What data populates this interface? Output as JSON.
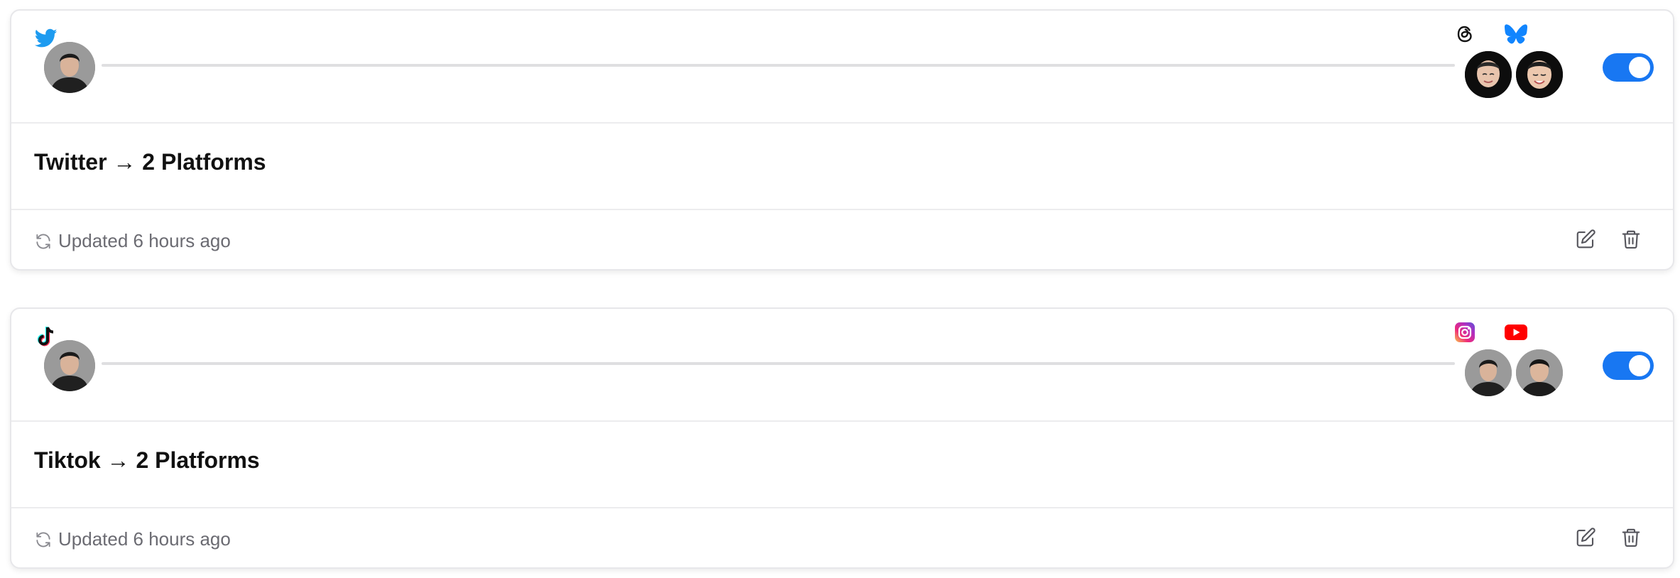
{
  "rules": [
    {
      "source_platform": "twitter-icon",
      "target_platforms": [
        "threads-icon",
        "bluesky-icon"
      ],
      "enabled": true,
      "title": "Twitter → 2 Platforms",
      "updated_label": "Updated 6 hours ago"
    },
    {
      "source_platform": "tiktok-icon",
      "target_platforms": [
        "instagram-icon",
        "youtube-icon"
      ],
      "enabled": true,
      "title": "Tiktok → 2 Platforms",
      "updated_label": "Updated 6 hours ago"
    }
  ],
  "colors": {
    "toggle_on": "#1877f2",
    "twitter": "#1d9bf0",
    "bluesky": "#1185fe",
    "youtube": "#ff0000",
    "text_primary": "#111111",
    "text_muted": "#6b6b72"
  }
}
